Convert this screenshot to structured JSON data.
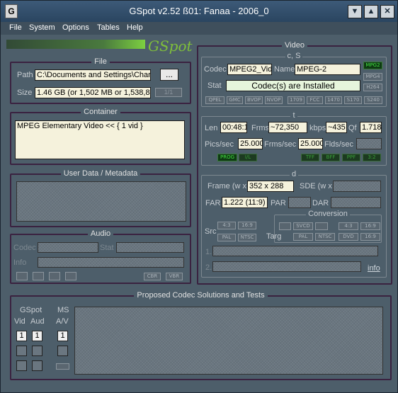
{
  "app": {
    "title": "GSpot v2.52 ß01: Fanaa - 2006_0",
    "logo": "GSpot",
    "icon_letter": "G"
  },
  "menu": [
    "File",
    "System",
    "Options",
    "Tables",
    "Help"
  ],
  "file": {
    "header": "File",
    "path_label": "Path",
    "path_value": "C:\\Documents and Settings\\Char",
    "browse_label": "...",
    "size_label": "Size",
    "size_value": "1.46 GB (or 1,502 MB or 1,538,81",
    "size_btn": "1/1"
  },
  "container": {
    "header": "Container",
    "value": "MPEG Elementary Video << { 1 vid }"
  },
  "userdata": {
    "header": "User Data / Metadata"
  },
  "audio": {
    "header": "Audio",
    "codec_label": "Codec",
    "stat_label": "Stat",
    "info_label": "Info",
    "cbr": "CBR",
    "vbr": "VBR"
  },
  "video": {
    "header": "Video",
    "cs_header": "c, S",
    "codec_label": "Codec",
    "codec_value": "MPEG2_Vid",
    "name_label": "Name",
    "name_value": "MPEG-2",
    "stat_label": "Stat",
    "stat_value": "Codec(s) are Installed",
    "codec_tags": [
      "MPG2",
      "MPG4",
      "H264"
    ],
    "feature_tags": [
      "QPEL",
      "GMC",
      "BVOP",
      "NVOP",
      "1709",
      "FCC",
      "1470",
      "S170",
      "S240"
    ],
    "t_header": "t",
    "len_label": "Len",
    "len_value": "00:48:1",
    "frms_label": "Frms",
    "frms_value": "~72,350",
    "kbps_label": "kbps",
    "kbps_value": "~435",
    "qf_label": "Qf",
    "qf_value": "1.718",
    "pics_label": "Pics/sec",
    "pics_value": "25.000",
    "frmssec_label": "Frms/sec",
    "frmssec_value": "25.000",
    "flds_label": "Flds/sec",
    "scan_tags": [
      "PROG",
      "I/L"
    ],
    "field_tags": [
      "TFF",
      "BFF",
      "PPF",
      "3:2"
    ],
    "d_header": "d",
    "frame_label": "Frame (w x",
    "frame_value": "352 x 288",
    "sde_label": "SDE (w x",
    "far_label": "FAR",
    "far_value": "1.222 (11:9)",
    "par_label": "PAR",
    "dar_label": "DAR",
    "conv_header": "Conversion",
    "src_label": "Src",
    "targ_label": "Targ",
    "src_tags": [
      "4:3",
      "16:9",
      "PAL",
      "NTSC"
    ],
    "targ_tags": [
      "VCD",
      "SVCD",
      "DVD",
      "4:3",
      "16:9",
      "PAL",
      "NTSC",
      "DVD",
      "16:9"
    ],
    "line1": "1.",
    "line2": "2.",
    "info_link": "info"
  },
  "codec_sol": {
    "header": "Proposed Codec Solutions and Tests",
    "gspot_label": "GSpot",
    "ms_label": "MS",
    "vid_label": "Vid",
    "aud_label": "Aud",
    "av_label": "A/V",
    "vid_1": "1",
    "aud_1": "1",
    "av_1": "1"
  },
  "colors": {
    "accent_green": "#44e044",
    "panel": "#4d5e6a",
    "border": "#3a2240"
  }
}
